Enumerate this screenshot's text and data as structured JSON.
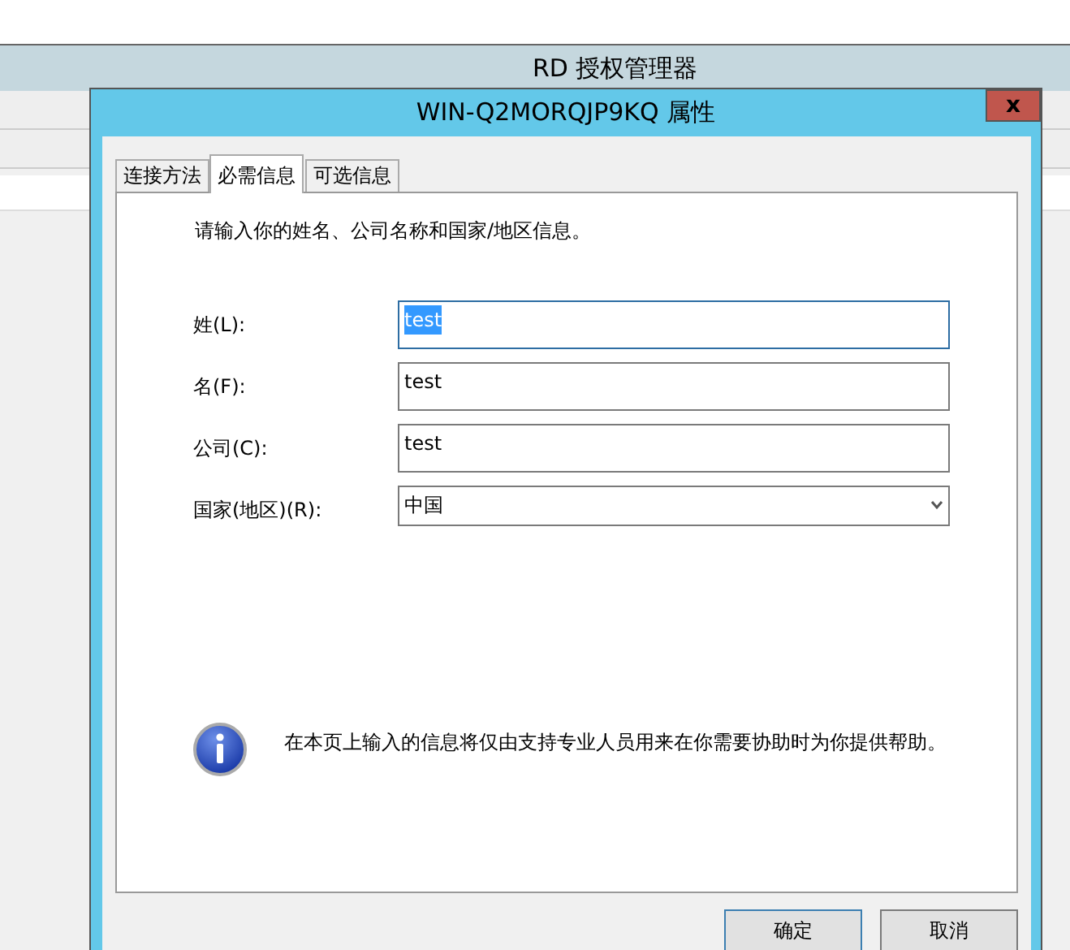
{
  "background_window": {
    "title": "RD 授权管理器"
  },
  "dialog": {
    "title": "WIN-Q2MORQJP9KQ 属性",
    "close": "x"
  },
  "tabs": [
    {
      "label": "连接方法",
      "selected": false
    },
    {
      "label": "必需信息",
      "selected": true
    },
    {
      "label": "可选信息",
      "selected": false
    }
  ],
  "intro": "请输入你的姓名、公司名称和国家/地区信息。",
  "fields": [
    {
      "kind": "text",
      "label": "姓(L):",
      "value": "test",
      "selected": true
    },
    {
      "kind": "text",
      "label": "名(F):",
      "value": "test",
      "selected": false
    },
    {
      "kind": "text",
      "label": "公司(C):",
      "value": "test",
      "selected": false
    },
    {
      "kind": "select",
      "label": "国家(地区)(R):",
      "value": "中国",
      "selected": false
    }
  ],
  "note": "在本页上输入的信息将仅由支持专业人员用来在你需要协助时为你提供帮助。",
  "buttons": [
    {
      "label": "确定",
      "selected": true
    },
    {
      "label": "取消",
      "selected": false
    }
  ]
}
